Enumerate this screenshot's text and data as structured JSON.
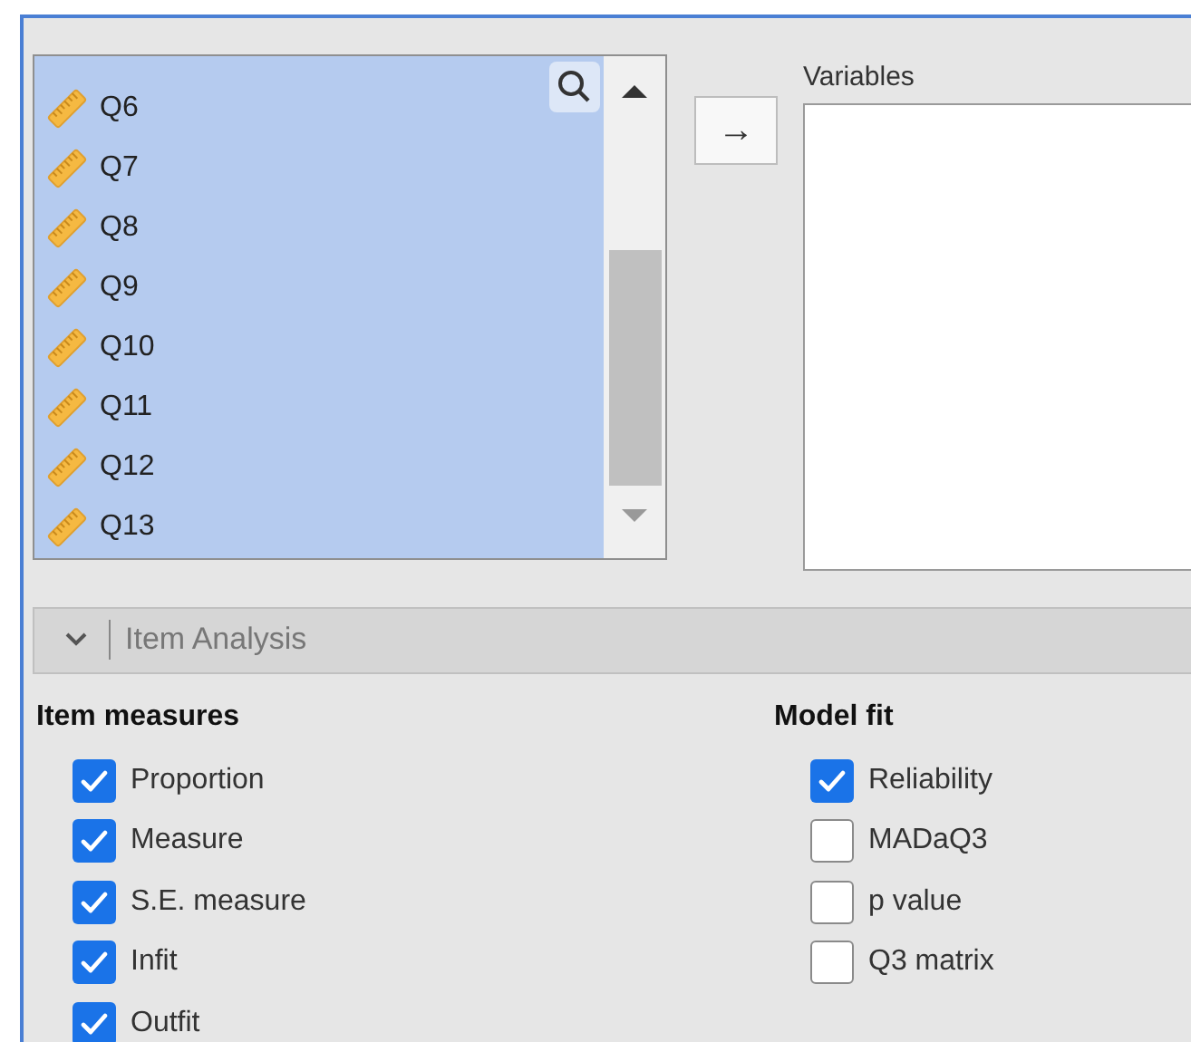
{
  "available_variables": [
    {
      "name": "Q6",
      "selected": true
    },
    {
      "name": "Q7",
      "selected": true
    },
    {
      "name": "Q8",
      "selected": true
    },
    {
      "name": "Q9",
      "selected": true
    },
    {
      "name": "Q10",
      "selected": true
    },
    {
      "name": "Q11",
      "selected": true
    },
    {
      "name": "Q12",
      "selected": true
    },
    {
      "name": "Q13",
      "selected": true
    }
  ],
  "move_button": {
    "label": "→"
  },
  "variables_box": {
    "label": "Variables"
  },
  "section": {
    "title": "Item Analysis",
    "expanded": true
  },
  "groups": [
    {
      "heading": "Item measures",
      "options": [
        {
          "label": "Proportion",
          "checked": true
        },
        {
          "label": "Measure",
          "checked": true
        },
        {
          "label": "S.E. measure",
          "checked": true
        },
        {
          "label": "Infit",
          "checked": true
        },
        {
          "label": "Outfit",
          "checked": true
        }
      ]
    },
    {
      "heading": "Model fit",
      "options": [
        {
          "label": "Reliability",
          "checked": true
        },
        {
          "label": "MADaQ3",
          "checked": false
        },
        {
          "label": "p value",
          "checked": false
        },
        {
          "label": "Q3 matrix",
          "checked": false
        }
      ]
    }
  ]
}
